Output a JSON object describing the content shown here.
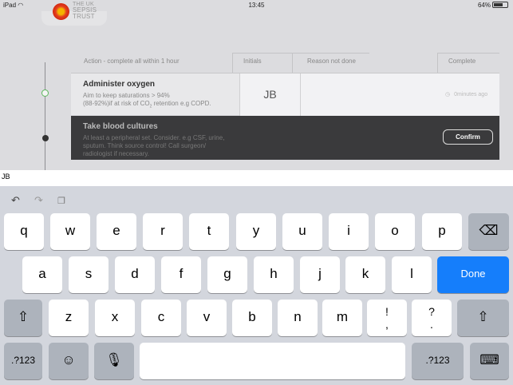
{
  "status_bar": {
    "device": "iPad",
    "time": "13:45",
    "battery": "64%"
  },
  "logo": {
    "line1": "THE UK",
    "line2": "SEPSIS",
    "line3": "TRUST"
  },
  "table": {
    "headers": {
      "action": "Action - complete all within 1 hour",
      "initials": "Initials",
      "reason": "Reason not done",
      "complete": "Complete"
    },
    "rows": [
      {
        "title": "Administer oxygen",
        "desc1": "Aim to keep saturations > 94%",
        "desc2": "(88-92%)if at risk of CO",
        "desc2_sub": "2",
        "desc3": " retention e.g COPD.",
        "initials": "JB",
        "time": "0minutes ago"
      },
      {
        "title": "Take blood cultures",
        "desc": "At least a peripheral set. Consider. e.g CSF, urine, sputum. Think source control! Call surgeon/ radiologist if necessary.",
        "button": "Confirm"
      }
    ]
  },
  "input": {
    "value": "JB"
  },
  "keyboard": {
    "row1": [
      "q",
      "w",
      "e",
      "r",
      "t",
      "y",
      "u",
      "i",
      "o",
      "p"
    ],
    "row2": [
      "a",
      "s",
      "d",
      "f",
      "g",
      "h",
      "j",
      "k",
      "l"
    ],
    "row3": [
      "z",
      "x",
      "c",
      "v",
      "b",
      "n",
      "m"
    ],
    "punct1": {
      "top": "!",
      "bottom": ","
    },
    "punct2": {
      "top": "?",
      "bottom": "."
    },
    "done": "Done",
    "numbers": ".?123",
    "icons": {
      "undo": "undo-icon",
      "redo": "redo-icon",
      "paste": "paste-icon",
      "backspace": "backspace-icon",
      "shift": "shift-icon",
      "emoji": "emoji-icon",
      "mic": "microphone-icon",
      "hide": "keyboard-hide-icon"
    },
    "accent": "#157efb"
  }
}
